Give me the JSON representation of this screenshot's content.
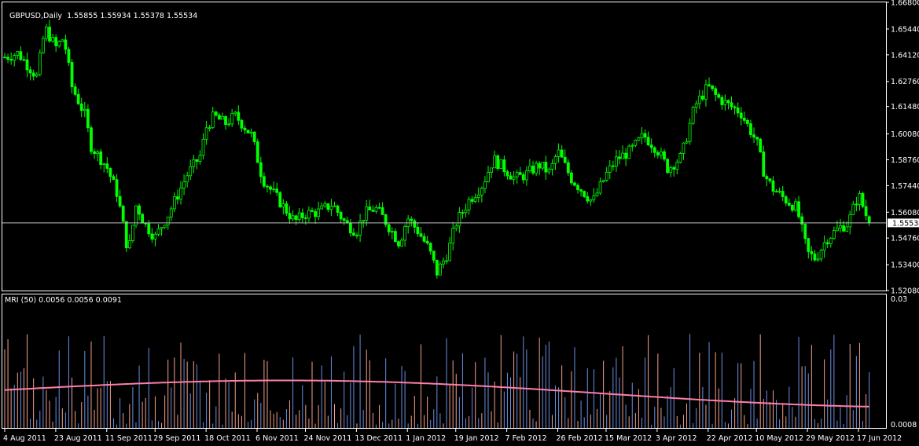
{
  "price_pane": {
    "symbol": "GBPUSD,Daily",
    "ohlc": "1.55855 1.55934 1.55378 1.55534",
    "y_ticks": [
      "1.66800",
      "1.65440",
      "1.64120",
      "1.62760",
      "1.61480",
      "1.60080",
      "1.58760",
      "1.57440",
      "1.56080",
      "1.54760",
      "1.53400",
      "1.52080"
    ],
    "current_price": "1.55534",
    "grid": false,
    "colors": {
      "candle": "#00ff00",
      "background": "#000000",
      "frame": "#ffffff",
      "price_line": "#c0c0c0"
    }
  },
  "indicator_pane": {
    "label": "MRI (50) 0.0056 0.0056 0.0091",
    "y_top_label": "0.03",
    "y_bottom_label": "0.0008",
    "colors": {
      "hist_down": "#f4a08a",
      "hist_up": "#6a8fe0",
      "avg_line": "#ff7fa8"
    }
  },
  "x_ticks": [
    "4 Aug 2011",
    "23 Aug 2011",
    "11 Sep 2011",
    "29 Sep 2011",
    "18 Oct 2011",
    "6 Nov 2011",
    "24 Nov 2011",
    "13 Dec 2011",
    "1 Jan 2012",
    "19 Jan 2012",
    "7 Feb 2012",
    "26 Feb 2012",
    "15 Mar 2012",
    "3 Apr 2012",
    "22 Apr 2012",
    "10 May 2012",
    "29 May 2012",
    "17 Jun 2012"
  ],
  "chart_data": [
    {
      "type": "candlestick",
      "title": "GBPUSD,Daily",
      "x_range": [
        "4 Aug 2011",
        "21 Jun 2012"
      ],
      "ylim": [
        1.5208,
        1.668
      ],
      "grid": false,
      "x_ticks": [
        "4 Aug 2011",
        "23 Aug 2011",
        "11 Sep 2011",
        "29 Sep 2011",
        "18 Oct 2011",
        "6 Nov 2011",
        "24 Nov 2011",
        "13 Dec 2011",
        "1 Jan 2012",
        "19 Jan 2012",
        "7 Feb 2012",
        "26 Feb 2012",
        "15 Mar 2012",
        "3 Apr 2012",
        "22 Apr 2012",
        "10 May 2012",
        "29 May 2012",
        "17 Jun 2012"
      ],
      "close_path": {
        "x": [
          "4 Aug 2011",
          "9 Aug 2011",
          "16 Aug 2011",
          "19 Aug 2011",
          "23 Aug 2011",
          "26 Aug 2011",
          "29 Aug 2011",
          "3 Sep 2011",
          "5 Sep 2011",
          "11 Sep 2011",
          "15 Sep 2011",
          "19 Sep 2011",
          "22 Sep 2011",
          "25 Sep 2011",
          "29 Sep 2011",
          "4 Oct 2011",
          "11 Oct 2011",
          "16 Oct 2011",
          "18 Oct 2011",
          "21 Oct 2011",
          "25 Oct 2011",
          "27 Oct 2011",
          "29 Oct 2011",
          "4 Nov 2011",
          "8 Nov 2011",
          "14 Nov 2011",
          "20 Nov 2011",
          "24 Nov 2011",
          "29 Nov 2011",
          "4 Dec 2011",
          "9 Dec 2011",
          "13 Dec 2011",
          "16 Dec 2011",
          "20 Dec 2011",
          "23 Dec 2011",
          "29 Dec 2011",
          "1 Jan 2012",
          "5 Jan 2012",
          "9 Jan 2012",
          "12 Jan 2012",
          "16 Jan 2012",
          "19 Jan 2012",
          "24 Jan 2012",
          "29 Jan 2012",
          "2 Feb 2012",
          "7 Feb 2012",
          "10 Feb 2012",
          "14 Feb 2012",
          "19 Feb 2012",
          "23 Feb 2012",
          "26 Feb 2012",
          "2 Mar 2012",
          "6 Mar 2012",
          "10 Mar 2012",
          "15 Mar 2012",
          "19 Mar 2012",
          "24 Mar 2012",
          "29 Mar 2012",
          "3 Apr 2012",
          "7 Apr 2012",
          "12 Apr 2012",
          "17 Apr 2012",
          "22 Apr 2012",
          "25 Apr 2012",
          "29 Apr 2012",
          "4 May 2012",
          "10 May 2012",
          "13 May 2012",
          "16 May 2012",
          "21 May 2012",
          "25 May 2012",
          "29 May 2012",
          "1 Jun 2012",
          "5 Jun 2012",
          "10 Jun 2012",
          "13 Jun 2012",
          "17 Jun 2012",
          "21 Jun 2012"
        ],
        "close": [
          1.64,
          1.642,
          1.63,
          1.655,
          1.645,
          1.65,
          1.625,
          1.61,
          1.595,
          1.584,
          1.57,
          1.54,
          1.565,
          1.555,
          1.548,
          1.56,
          1.58,
          1.59,
          1.604,
          1.61,
          1.606,
          1.608,
          1.61,
          1.6,
          1.578,
          1.567,
          1.556,
          1.56,
          1.561,
          1.565,
          1.555,
          1.551,
          1.56,
          1.563,
          1.558,
          1.545,
          1.558,
          1.551,
          1.542,
          1.53,
          1.54,
          1.555,
          1.567,
          1.575,
          1.588,
          1.582,
          1.578,
          1.58,
          1.585,
          1.581,
          1.592,
          1.578,
          1.572,
          1.566,
          1.58,
          1.588,
          1.592,
          1.6,
          1.593,
          1.583,
          1.589,
          1.615,
          1.625,
          1.62,
          1.616,
          1.612,
          1.597,
          1.58,
          1.573,
          1.567,
          1.563,
          1.54,
          1.537,
          1.547,
          1.553,
          1.555,
          1.57,
          1.555
        ]
      },
      "last": {
        "open": 1.55855,
        "high": 1.55934,
        "low": 1.55378,
        "close": 1.55534
      }
    },
    {
      "type": "bar",
      "title": "MRI (50)",
      "series": [
        {
          "name": "MRI (50)",
          "values": [
            0.0056,
            0.0056,
            0.0091
          ]
        }
      ],
      "ylim": [
        0.0008,
        0.03
      ]
    }
  ]
}
